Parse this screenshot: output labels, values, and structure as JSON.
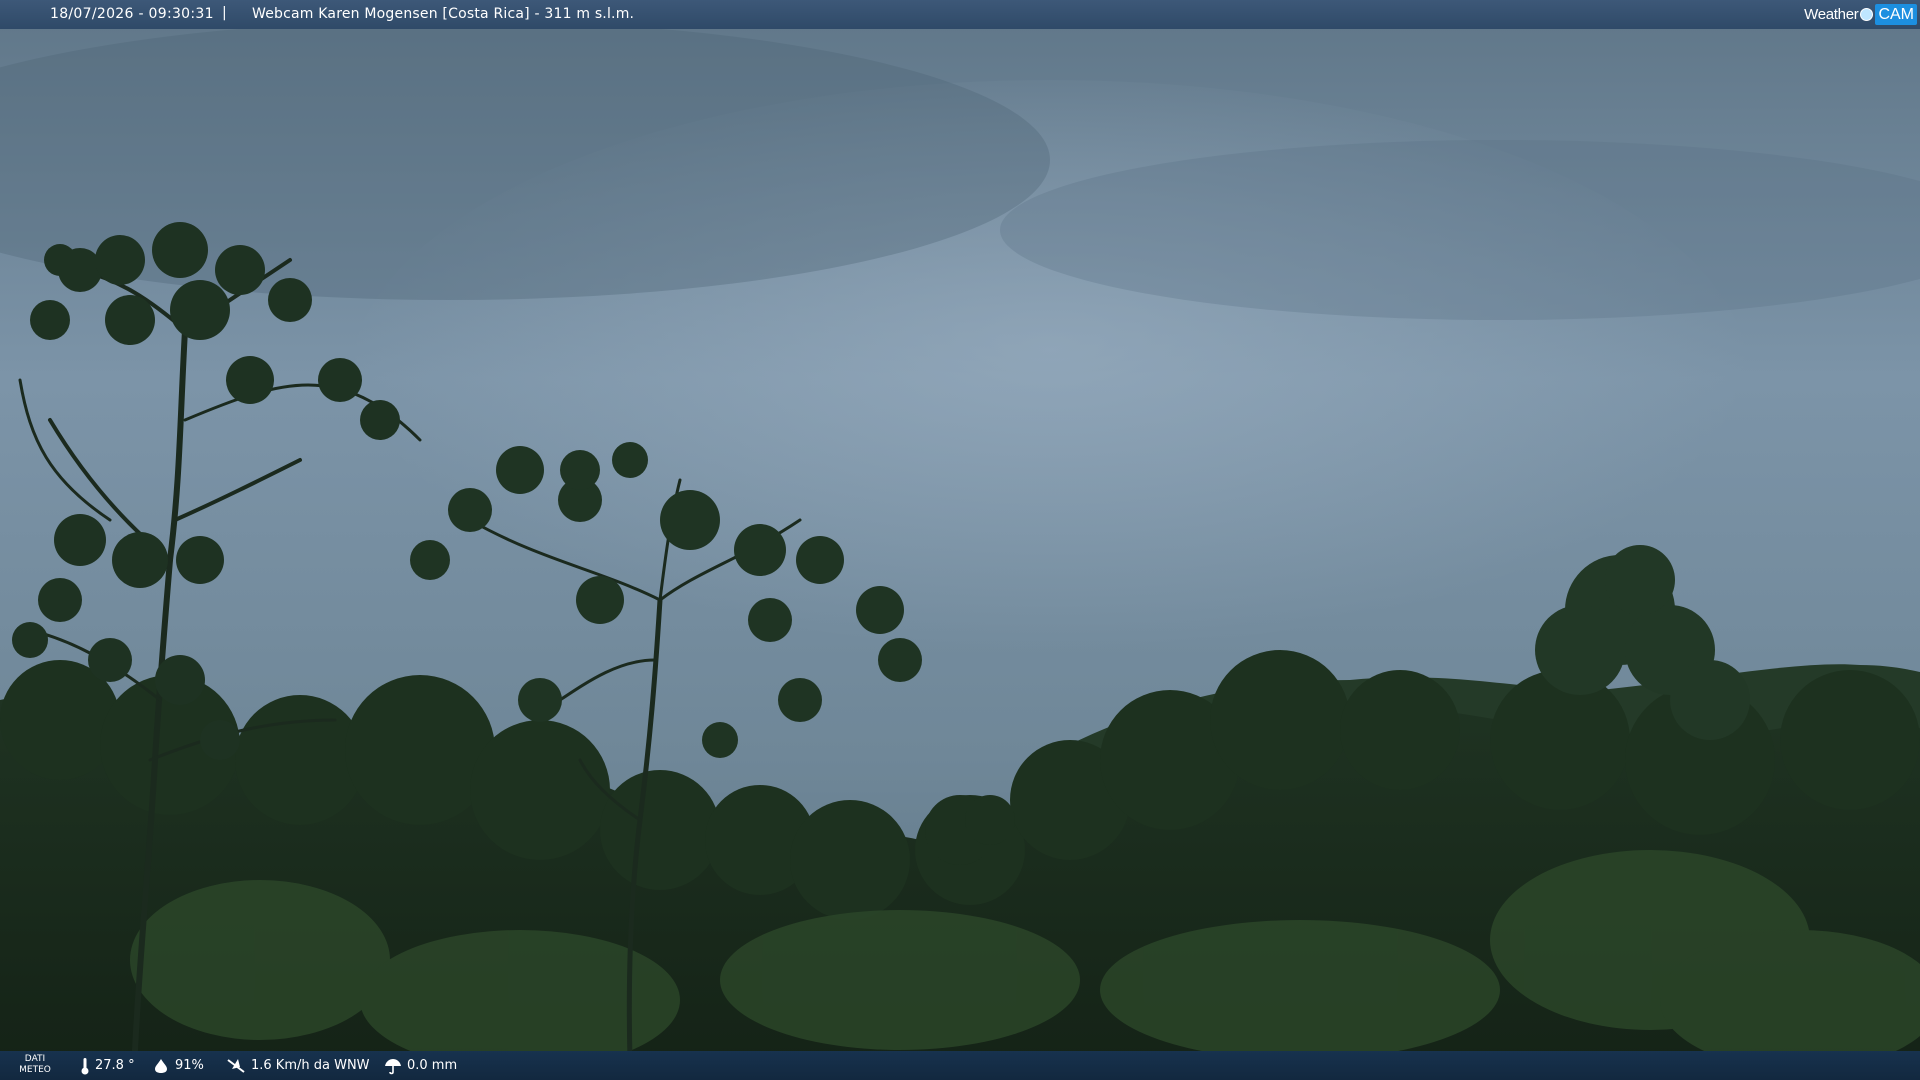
{
  "header": {
    "timestamp": "18/07/2026 - 09:30:31",
    "separator": "|",
    "title": "Webcam Karen Mogensen [Costa Rica] - 311 m s.l.m."
  },
  "logo": {
    "word": "Weather",
    "cam": "CAM"
  },
  "footer": {
    "label_line1": "DATI",
    "label_line2": "METEO",
    "temperature": "27.8 °",
    "humidity": "91%",
    "wind": "1.6 Km/h da WNW",
    "rain": "0.0 mm"
  },
  "icons": {
    "temperature": "thermometer-icon",
    "humidity": "droplet-icon",
    "wind": "wind-icon",
    "rain": "umbrella-icon"
  }
}
